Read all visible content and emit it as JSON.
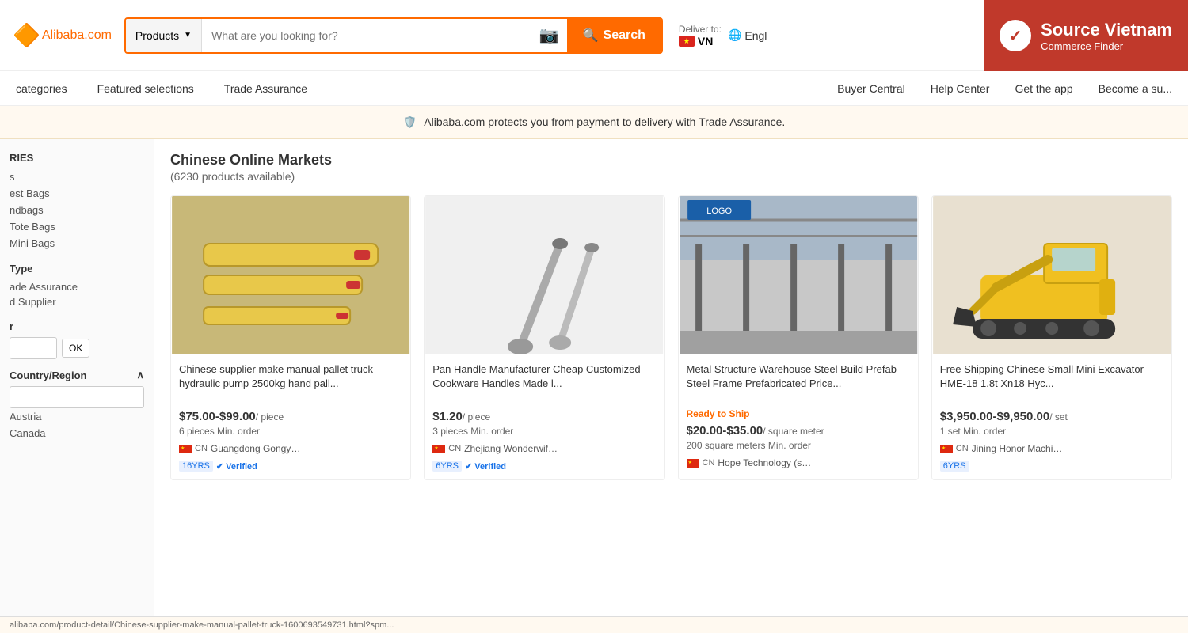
{
  "header": {
    "logo": "Alibaba.com",
    "logo_alibaba": "Alibaba",
    "logo_com": ".com",
    "search_category": "Products",
    "search_placeholder": "What are you looking for?",
    "search_btn": "Search",
    "deliver_label": "Deliver to:",
    "country": "VN",
    "language": "Engl"
  },
  "source_vietnam": {
    "title": "Source Vietnam",
    "subtitle": "Commerce Finder"
  },
  "navbar": {
    "left_items": [
      "categories",
      "Featured selections",
      "Trade Assurance"
    ],
    "right_items": [
      "Buyer Central",
      "Help Center",
      "Get the app",
      "Become a su..."
    ]
  },
  "ta_banner": {
    "text": "Alibaba.com protects you from payment to delivery with Trade Assurance."
  },
  "sidebar": {
    "categories_label": "RIES",
    "items": [
      "s",
      "est Bags",
      "ndbags",
      "Tote Bags",
      "Mini Bags"
    ],
    "type_label": "Type",
    "type_items": [
      "ade Assurance",
      "d Supplier"
    ],
    "price_label": "r",
    "ok_btn": "OK",
    "country_label": "Country/Region",
    "country_items": [
      "Austria",
      "Canada"
    ]
  },
  "products_area": {
    "market_title": "Chinese Online Markets",
    "market_count": "(6230 products available)",
    "products": [
      {
        "id": 1,
        "title": "Chinese supplier make manual pallet truck hydraulic pump 2500kg hand pall...",
        "price": "$75.00-$99.00",
        "price_unit": "/ piece",
        "min_order": "6 pieces Min. order",
        "ready_ship": false,
        "flag": "CN",
        "supplier": "Guangdong Gongyou Lift Sling...",
        "years": "16YRS",
        "verified": true,
        "color": "#e8c84a",
        "type": "pallet_truck"
      },
      {
        "id": 2,
        "title": "Pan Handle Manufacturer Cheap Customized Cookware Handles Made l...",
        "price": "$1.20",
        "price_unit": "/ piece",
        "min_order": "3 pieces Min. order",
        "ready_ship": false,
        "flag": "CN",
        "supplier": "Zhejiang Wonderwife...",
        "years": "6YRS",
        "verified": true,
        "color": "#aaa",
        "type": "pan_handle"
      },
      {
        "id": 3,
        "title": "Metal Structure Warehouse Steel Build Prefab Steel Frame Prefabricated Price...",
        "price": "$20.00-$35.00",
        "price_unit": "/ square meter",
        "min_order": "200 square meters Min. order",
        "ready_ship": true,
        "ready_ship_text": "Ready to Ship",
        "flag": "CN",
        "supplier": "Hope Technology (shandong)...",
        "years": "",
        "verified": false,
        "color": "#888",
        "type": "warehouse"
      },
      {
        "id": 4,
        "title": "Free Shipping Chinese Small Mini Excavator HME-18 1.8t Xn18 Hyc...",
        "price": "$3,950.00-$9,950.00",
        "price_unit": "/ set",
        "min_order": "1 set Min. order",
        "ready_ship": false,
        "flag": "CN",
        "supplier": "Jining Honor Machinery",
        "years": "6YRS",
        "verified": false,
        "color": "#f0c020",
        "type": "excavator"
      }
    ]
  },
  "status_bar": {
    "text": "alibaba.com/product-detail/Chinese-supplier-make-manual-pallet-truck-1600693549731.html?spm..."
  }
}
